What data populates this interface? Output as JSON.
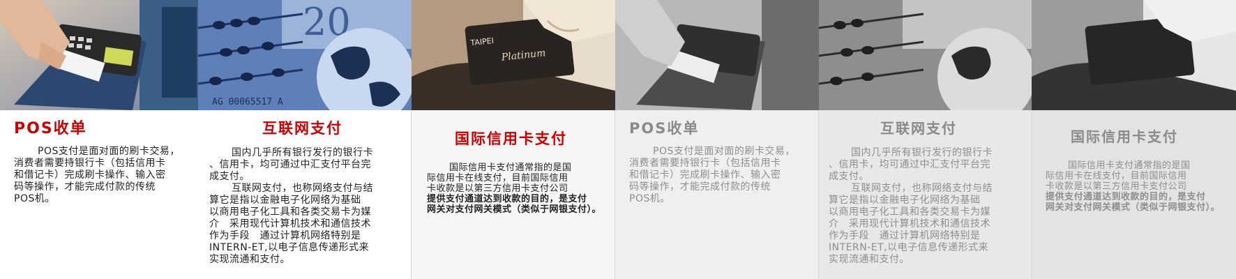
{
  "colors": {
    "active_title": "#cc0000",
    "active_text": "#222222",
    "inactive_title": "#8a8a8a",
    "inactive_text": "#8e8e8e"
  },
  "panels": [
    {
      "title": "POS收单",
      "lines": [
        "POS支付是面对面的刷卡交易，",
        "消费者需要持银行卡（包括信用卡",
        "和借记卡）完成刷卡操作、输入密",
        "码等操作，才能完成付款的传统",
        "POS机。"
      ]
    },
    {
      "title": "互联网支付",
      "lines": [
        "国内几乎所有银行发行的银行卡",
        "、信用卡，均可通过中汇支付平台完",
        "成支付。",
        "互联网支付，也称网络支付与结",
        "算它是指以金融电子化网络为基础",
        "以商用电子化工具和各类交易卡为媒",
        "介　采用现代计算机技术和通信技术",
        "作为手段　通过计算机网络特别是",
        "INTERN-ET,以电子信息传递形式来",
        "实现流通和支付。"
      ]
    },
    {
      "title": "国际信用卡支付",
      "lines": [
        "国际信用卡支付通常指的是国",
        "际信用卡在线支付，目前国际信用",
        "卡收款是以第三方信用卡支付公司",
        "提供支付通道达到收款的目的，是支付",
        "网关对支付网关模式（类似于网银支付）。"
      ]
    },
    {
      "title": "POS收单",
      "lines": [
        "POS支付是面对面的刷卡交易，",
        "消费者需要持银行卡（包括信用卡",
        "和借记卡）完成刷卡操作、输入密",
        "码等操作，才能完成付款的传统",
        "POS机。"
      ]
    },
    {
      "title": "互联网支付",
      "lines": [
        "国内几乎所有银行发行的银行卡",
        "、信用卡，均可通过中汇支付平台完",
        "成支付。",
        "互联网支付，也称网络支付与结",
        "算它是指以金融电子化网络为基础",
        "以商用电子化工具和各类交易卡为媒",
        "介　采用现代计算机技术和通信技术",
        "作为手段　通过计算机网络特别是",
        "INTERN-ET,以电子信息传递形式来",
        "实现流通和支付。"
      ]
    },
    {
      "title": "国际信用卡支付",
      "lines": [
        "国际信用卡支付通常指的是国",
        "际信用卡在线支付，目前国际信用",
        "卡收款是以第三方信用卡支付公司",
        "提供支付通道达到收款的目的，是支付",
        "网关对支付网关模式（类似于网银支付）。"
      ]
    }
  ],
  "photos": {
    "banknote_text": "20",
    "serial_text": "AG 00065517 A",
    "card_brand": "TAIPEI",
    "card_name": "Platinum"
  }
}
